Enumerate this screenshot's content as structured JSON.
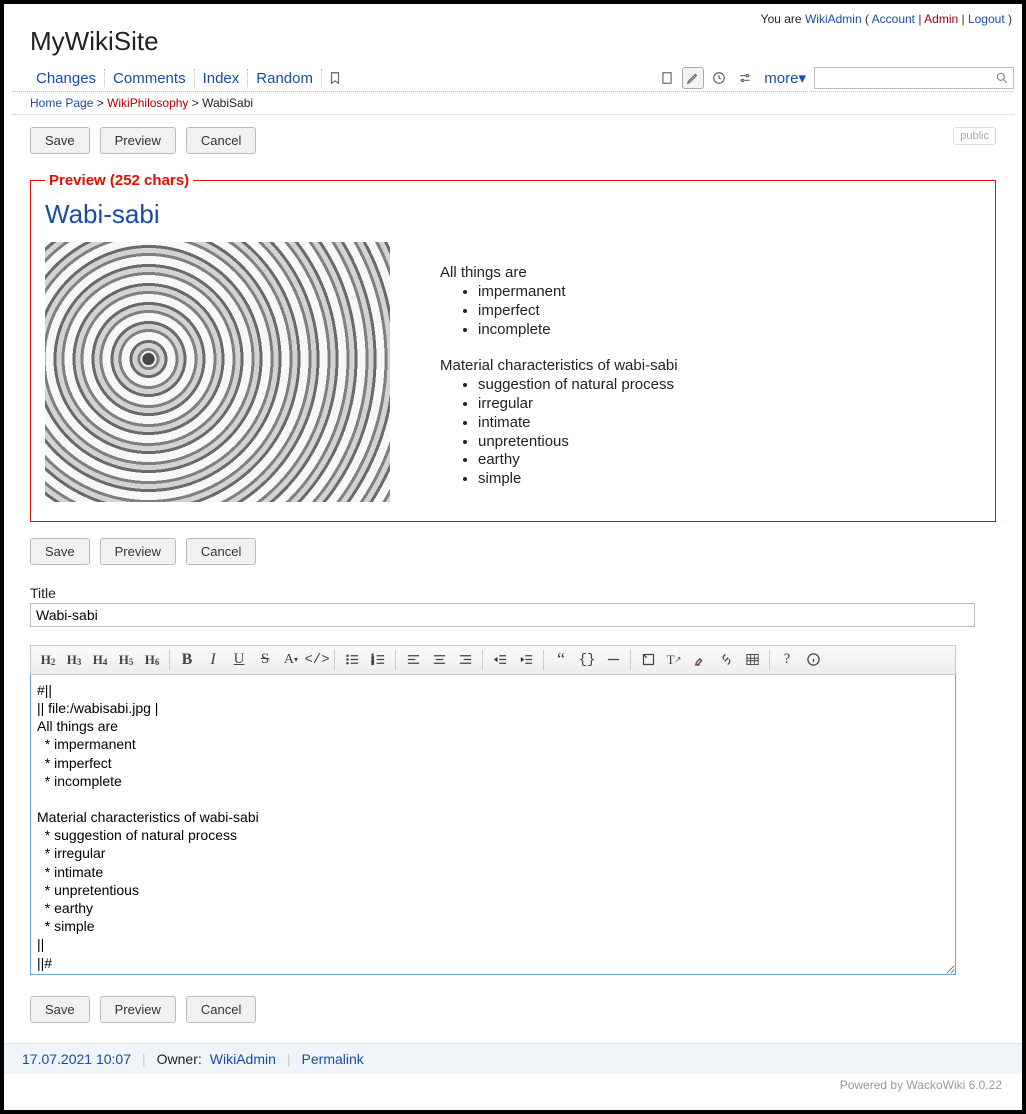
{
  "userbar": {
    "youare": "You are",
    "username": "WikiAdmin",
    "account": "Account",
    "admin": "Admin",
    "logout": "Logout"
  },
  "site": {
    "title": "MyWikiSite"
  },
  "nav": {
    "changes": "Changes",
    "comments": "Comments",
    "index": "Index",
    "random": "Random",
    "more": "more▾"
  },
  "breadcrumb": {
    "home": "Home Page",
    "l1": "WikiPhilosophy",
    "l2": "WabiSabi"
  },
  "buttons": {
    "save": "Save",
    "preview": "Preview",
    "cancel": "Cancel",
    "public": "public"
  },
  "preview": {
    "legend": "Preview (252 chars)",
    "title": "Wabi-sabi",
    "p1": "All things are",
    "list1": {
      "a": "impermanent",
      "b": "imperfect",
      "c": "incomplete"
    },
    "p2": "Material characteristics of wabi-sabi",
    "list2": {
      "a": "suggestion of natural process",
      "b": "irregular",
      "c": "intimate",
      "d": "unpretentious",
      "e": "earthy",
      "f": "simple"
    }
  },
  "form": {
    "titlelabel": "Title",
    "titlevalue": "Wabi-sabi",
    "body": "#||\n|| file:/wabisabi.jpg |\nAll things are\n  * impermanent\n  * imperfect\n  * incomplete\n\nMaterial characteristics of wabi-sabi\n  * suggestion of natural process\n  * irregular\n  * intimate\n  * unpretentious\n  * earthy\n  * simple\n||\n||#"
  },
  "footer": {
    "date": "17.07.2021 10:07",
    "ownerlabel": "Owner:",
    "owner": "WikiAdmin",
    "permalink": "Permalink",
    "powered": "Powered by WackoWiki 6.0.22"
  }
}
